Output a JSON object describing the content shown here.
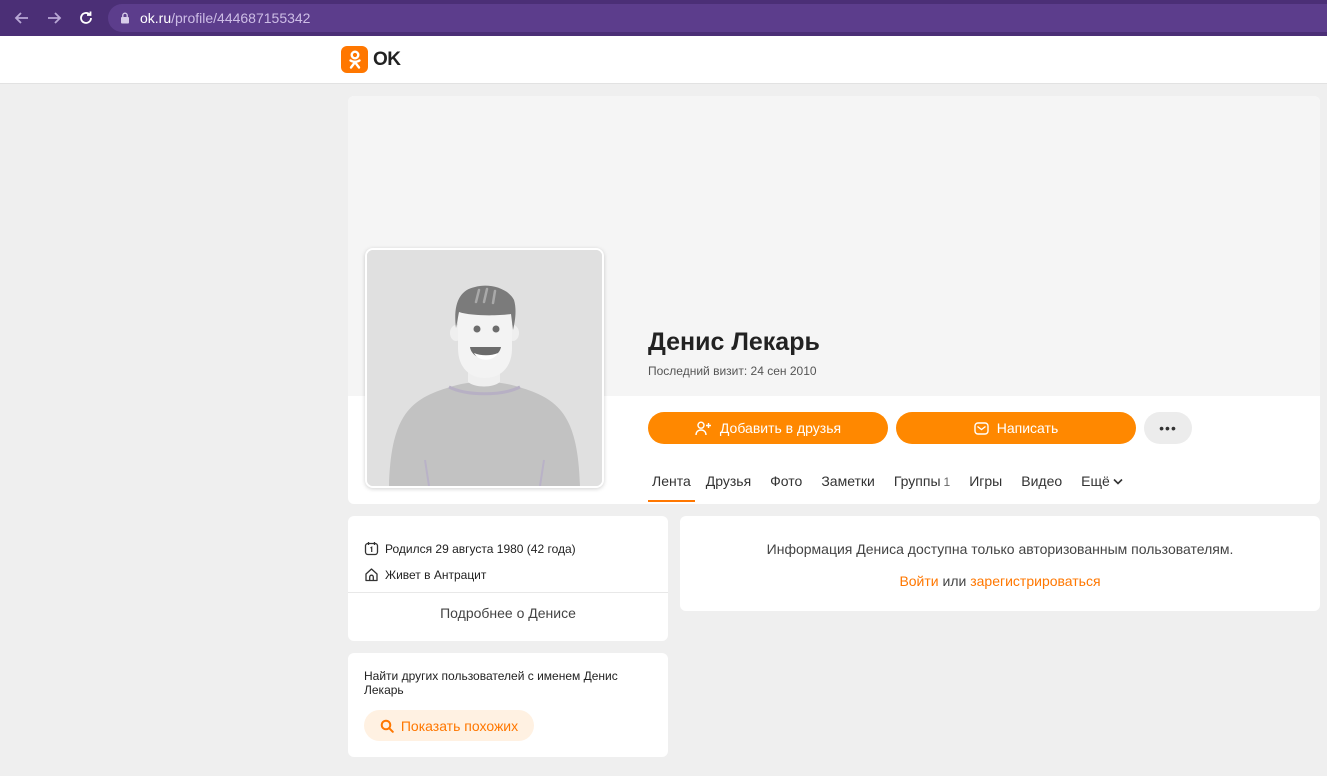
{
  "browser": {
    "url_host": "ok.ru",
    "url_path": "/profile/444687155342"
  },
  "header": {
    "logo_text": "OK"
  },
  "profile": {
    "name": "Денис Лекарь",
    "last_visit": "Последний визит: 24 сен 2010",
    "add_friend_label": "Добавить в друзья",
    "message_label": "Написать",
    "more_actions_label": "•••"
  },
  "tabs": [
    {
      "label": "Лента",
      "active": true
    },
    {
      "label": "Друзья"
    },
    {
      "label": "Фото"
    },
    {
      "label": "Заметки"
    },
    {
      "label": "Группы",
      "count": "1"
    },
    {
      "label": "Игры"
    },
    {
      "label": "Видео"
    },
    {
      "label": "Ещё"
    }
  ],
  "info": {
    "birth": "Родился 29 августа 1980 (42 года)",
    "city": "Живет в Антрацит",
    "more_about": "Подробнее о Денисе"
  },
  "search": {
    "text": "Найти других пользователей с именем Денис Лекарь",
    "button_label": "Показать похожих"
  },
  "restricted": {
    "message": "Информация Дениса доступна только авторизованным пользователям.",
    "login_label": "Войти",
    "or_label": "или",
    "register_label": "зарегистрироваться"
  },
  "colors": {
    "accent": "#ff8800",
    "browser_bar": "#4b2f76"
  }
}
